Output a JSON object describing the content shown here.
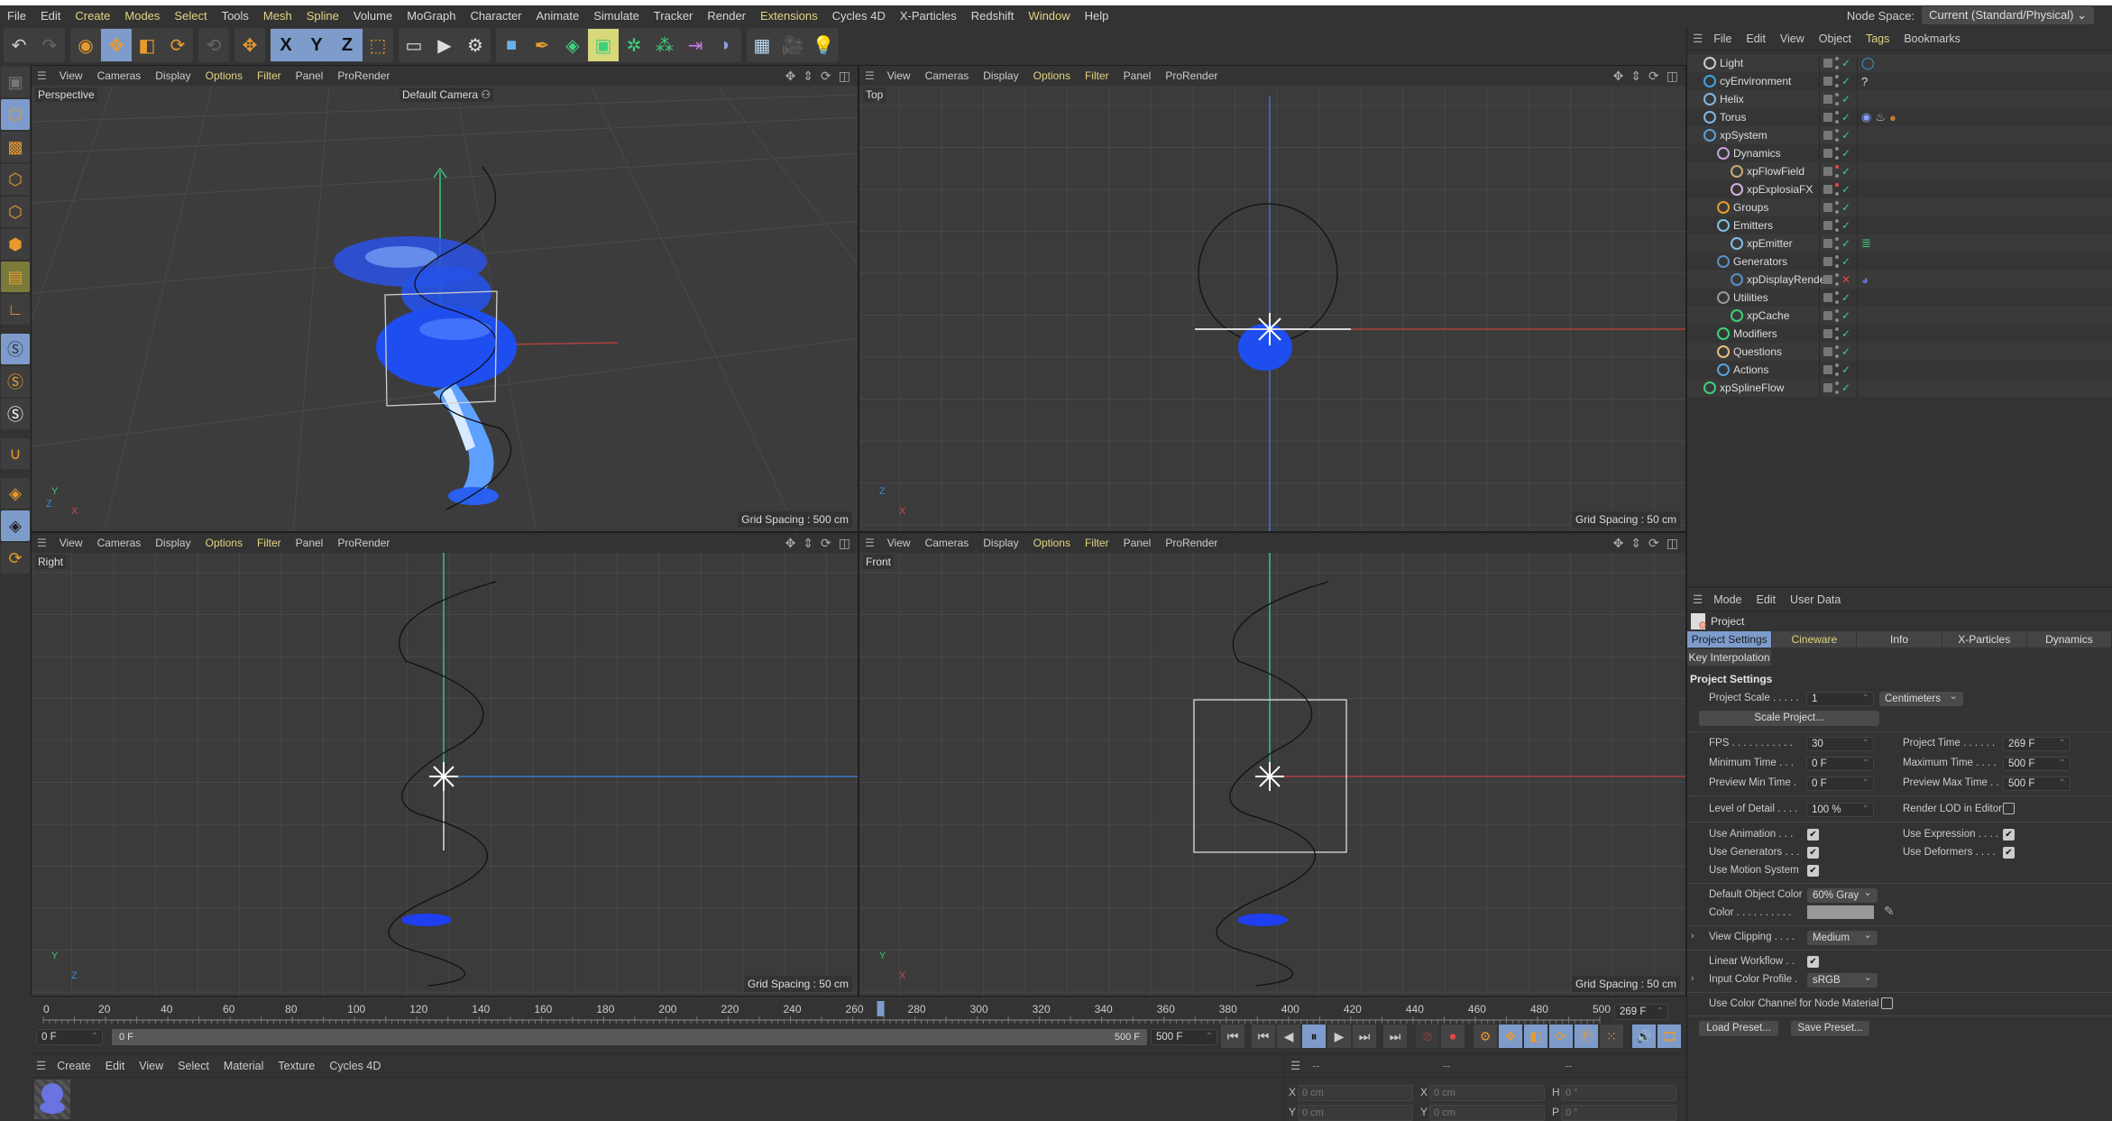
{
  "menubar": {
    "items": [
      {
        "label": "File",
        "hl": false
      },
      {
        "label": "Edit",
        "hl": false
      },
      {
        "label": "Create",
        "hl": true
      },
      {
        "label": "Modes",
        "hl": true
      },
      {
        "label": "Select",
        "hl": true
      },
      {
        "label": "Tools",
        "hl": false
      },
      {
        "label": "Mesh",
        "hl": true
      },
      {
        "label": "Spline",
        "hl": true
      },
      {
        "label": "Volume",
        "hl": false
      },
      {
        "label": "MoGraph",
        "hl": false
      },
      {
        "label": "Character",
        "hl": false
      },
      {
        "label": "Animate",
        "hl": false
      },
      {
        "label": "Simulate",
        "hl": false
      },
      {
        "label": "Tracker",
        "hl": false
      },
      {
        "label": "Render",
        "hl": false
      },
      {
        "label": "Extensions",
        "hl": true
      },
      {
        "label": "Cycles 4D",
        "hl": false
      },
      {
        "label": "X-Particles",
        "hl": false
      },
      {
        "label": "Redshift",
        "hl": false
      },
      {
        "label": "Window",
        "hl": true
      },
      {
        "label": "Help",
        "hl": false
      }
    ],
    "node_space_label": "Node Space:",
    "node_space_value": "Current (Standard/Physical)"
  },
  "toolbar": {
    "axis_x": "X",
    "axis_y": "Y",
    "axis_z": "Z"
  },
  "viewport_menu": [
    "View",
    "Cameras",
    "Display",
    "Options",
    "Filter",
    "Panel",
    "ProRender"
  ],
  "viewports": [
    {
      "name": "Perspective",
      "camera": "Default Camera",
      "grid_spacing": "Grid Spacing : 500 cm",
      "axes": [
        "Y",
        "Z",
        "X"
      ]
    },
    {
      "name": "Top",
      "grid_spacing": "Grid Spacing : 50 cm",
      "axes": [
        "Z",
        "X"
      ]
    },
    {
      "name": "Right",
      "grid_spacing": "Grid Spacing : 50 cm",
      "axes": [
        "Y",
        "Z"
      ]
    },
    {
      "name": "Front",
      "grid_spacing": "Grid Spacing : 50 cm",
      "axes": [
        "Y",
        "X"
      ]
    }
  ],
  "object_manager": {
    "menu": [
      "File",
      "Edit",
      "View",
      "Object",
      "Tags",
      "Bookmarks"
    ],
    "objects": [
      {
        "name": "Light",
        "indent": 0,
        "color": "#cccccc",
        "status": "check",
        "tags": [
          "light-tag"
        ]
      },
      {
        "name": "cyEnvironment",
        "indent": 0,
        "color": "#3aa7e0",
        "status": "check",
        "tags": [
          "unknown-tag"
        ]
      },
      {
        "name": "Helix",
        "indent": 0,
        "color": "#7fb8e8",
        "status": "check",
        "tags": []
      },
      {
        "name": "Torus",
        "indent": 0,
        "color": "#7fb8e8",
        "status": "check",
        "tags": [
          "vibrate-tag",
          "explosia-tag",
          "material-tag"
        ]
      },
      {
        "name": "xpSystem",
        "indent": 0,
        "color": "#5aa0d8",
        "status": "check",
        "tags": []
      },
      {
        "name": "Dynamics",
        "indent": 1,
        "color": "#c7a3d8",
        "status": "check",
        "tags": []
      },
      {
        "name": "xpFlowField",
        "indent": 2,
        "color": "#c9a87a",
        "status": "check",
        "tags": [],
        "red_dot": true
      },
      {
        "name": "xpExplosiaFX",
        "indent": 2,
        "color": "#d0b0e0",
        "status": "check",
        "tags": [],
        "red_dot": true
      },
      {
        "name": "Groups",
        "indent": 1,
        "color": "#e89a2e",
        "status": "check",
        "tags": []
      },
      {
        "name": "Emitters",
        "indent": 1,
        "color": "#7fc0e8",
        "status": "check",
        "tags": []
      },
      {
        "name": "xpEmitter",
        "indent": 2,
        "color": "#7fc0e8",
        "status": "check",
        "tags": [
          "cache-tag"
        ]
      },
      {
        "name": "Generators",
        "indent": 1,
        "color": "#5a90c8",
        "status": "check",
        "tags": []
      },
      {
        "name": "xpDisplayRender",
        "indent": 2,
        "color": "#5a90c8",
        "status": "x",
        "tags": [
          "cycles-tag"
        ]
      },
      {
        "name": "Utilities",
        "indent": 1,
        "color": "#999999",
        "status": "check",
        "tags": []
      },
      {
        "name": "xpCache",
        "indent": 2,
        "color": "#3ed07a",
        "status": "check",
        "tags": []
      },
      {
        "name": "Modifiers",
        "indent": 1,
        "color": "#3ed07a",
        "status": "check",
        "tags": []
      },
      {
        "name": "Questions",
        "indent": 1,
        "color": "#e3c07a",
        "status": "check",
        "tags": []
      },
      {
        "name": "Actions",
        "indent": 1,
        "color": "#5aa0d8",
        "status": "check",
        "tags": []
      },
      {
        "name": "xpSplineFlow",
        "indent": 0,
        "color": "#3ed07a",
        "status": "check",
        "tags": []
      }
    ]
  },
  "attribute_manager": {
    "menu": [
      "Mode",
      "Edit",
      "User Data"
    ],
    "object_title": "Project",
    "tabs": [
      "Project Settings",
      "Cineware",
      "Info",
      "X-Particles",
      "Dynamics"
    ],
    "active_tab": "Project Settings",
    "tab2": "Key Interpolation",
    "section": "Project Settings",
    "project_scale_label": "Project Scale . . . . .",
    "project_scale": "1",
    "scale_unit": "Centimeters",
    "scale_project_btn": "Scale Project...",
    "fps_label": "FPS . . . . . . . . . . .",
    "fps": "30",
    "project_time_label": "Project Time . . . . . .",
    "project_time": "269 F",
    "min_time_label": "Minimum Time . . .",
    "min_time": "0 F",
    "max_time_label": "Maximum Time . . . .",
    "max_time": "500 F",
    "prev_min_label": "Preview Min Time .",
    "prev_min": "0 F",
    "prev_max_label": "Preview Max Time . .",
    "prev_max": "500 F",
    "lod_label": "Level of Detail . . . .",
    "lod": "100 %",
    "render_lod_label": "Render LOD in Editor",
    "render_lod": false,
    "use_animation_label": "Use Animation . . .",
    "use_animation": true,
    "use_expression_label": "Use Expression . . . .",
    "use_expression": true,
    "use_generators_label": "Use Generators . . .",
    "use_generators": true,
    "use_deformers_label": "Use Deformers . . . .",
    "use_deformers": true,
    "use_motion_label": "Use Motion System",
    "use_motion": true,
    "default_color_label": "Default Object Color",
    "default_color": "60% Gray",
    "color_label": "Color . . . . . . . . . .",
    "color_swatch": "#999999",
    "view_clipping_label": "View Clipping . . . .",
    "view_clipping": "Medium",
    "linear_workflow_label": "Linear Workflow . .",
    "linear_workflow": true,
    "input_color_label": "Input Color Profile .",
    "input_color": "sRGB",
    "node_material_label": "Use Color Channel for Node Material",
    "node_material": false,
    "load_preset": "Load Preset...",
    "save_preset": "Save Preset..."
  },
  "timeline": {
    "ticks": [
      0,
      20,
      40,
      60,
      80,
      100,
      120,
      140,
      160,
      180,
      200,
      220,
      240,
      260,
      280,
      300,
      320,
      340,
      360,
      380,
      400,
      420,
      440,
      460,
      480,
      500
    ],
    "min_frame": 0,
    "max_frame": 500,
    "current_frame": 269,
    "current_frame_label": "269 F",
    "start_field": "0 F",
    "range_start": "0 F",
    "range_end": "500 F",
    "end_field": "500 F"
  },
  "material_manager": {
    "menu": [
      "Create",
      "Edit",
      "View",
      "Select",
      "Material",
      "Texture",
      "Cycles 4D"
    ]
  },
  "coordinates": {
    "header": [
      "--",
      "--",
      "--"
    ],
    "rows": [
      {
        "l1": "X",
        "v1": "0 cm",
        "l2": "X",
        "v2": "0 cm",
        "l3": "H",
        "v3": "0 °"
      },
      {
        "l1": "Y",
        "v1": "0 cm",
        "l2": "Y",
        "v2": "0 cm",
        "l3": "P",
        "v3": "0 °"
      }
    ]
  }
}
